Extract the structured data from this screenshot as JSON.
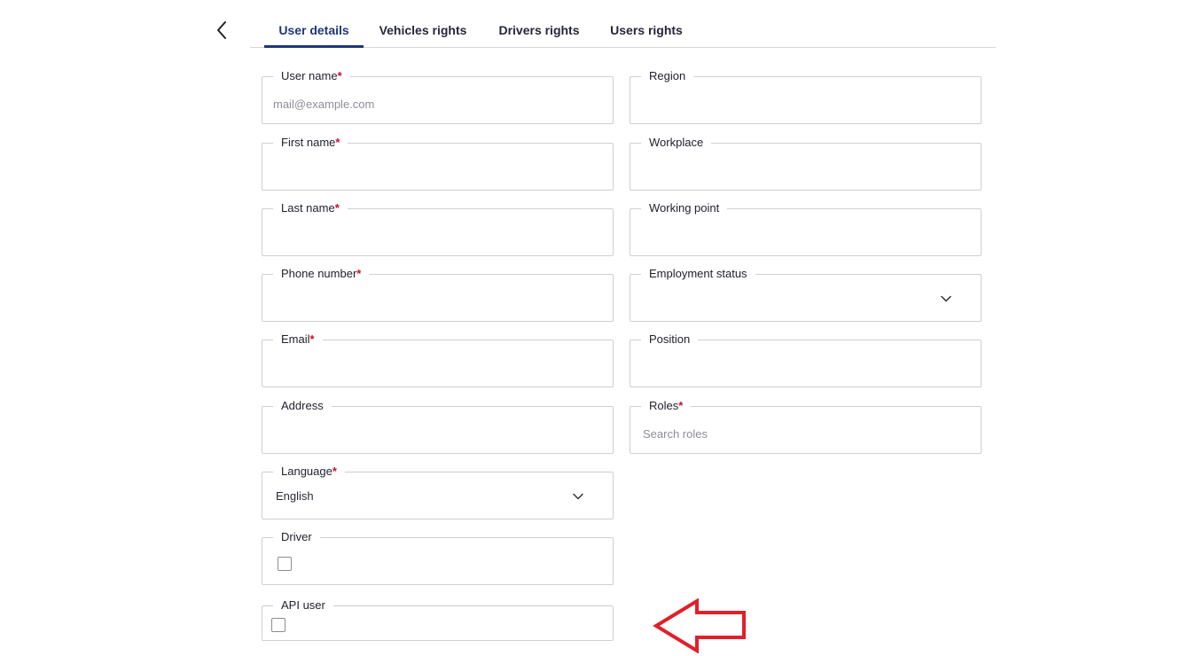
{
  "tabs": [
    {
      "label": "User details",
      "active": true
    },
    {
      "label": "Vehicles rights",
      "active": false
    },
    {
      "label": "Drivers rights",
      "active": false
    },
    {
      "label": "Users rights",
      "active": false
    }
  ],
  "form": {
    "user_name": {
      "label": "User name",
      "required": "*",
      "placeholder": "mail@example.com"
    },
    "first_name": {
      "label": "First name",
      "required": "*"
    },
    "last_name": {
      "label": "Last name",
      "required": "*"
    },
    "phone_number": {
      "label": "Phone number",
      "required": "*"
    },
    "email": {
      "label": "Email",
      "required": "*"
    },
    "address": {
      "label": "Address"
    },
    "language": {
      "label": "Language",
      "required": "*",
      "value": "English"
    },
    "driver": {
      "label": "Driver",
      "checked": false
    },
    "api_user": {
      "label": "API user",
      "checked": false
    },
    "region": {
      "label": "Region"
    },
    "workplace": {
      "label": "Workplace"
    },
    "working_point": {
      "label": "Working point"
    },
    "employment_status": {
      "label": "Employment status",
      "value": ""
    },
    "position": {
      "label": "Position"
    },
    "roles": {
      "label": "Roles",
      "required": "*",
      "placeholder": "Search roles"
    }
  },
  "icons": {
    "back": "chevron-left-icon",
    "dropdown": "chevron-down-icon",
    "annotation": "arrow-left-outline"
  },
  "colors": {
    "accent": "#1f3679",
    "required": "#c8102e",
    "annotation_arrow": "#e0202a",
    "border": "#cfcfd6"
  }
}
